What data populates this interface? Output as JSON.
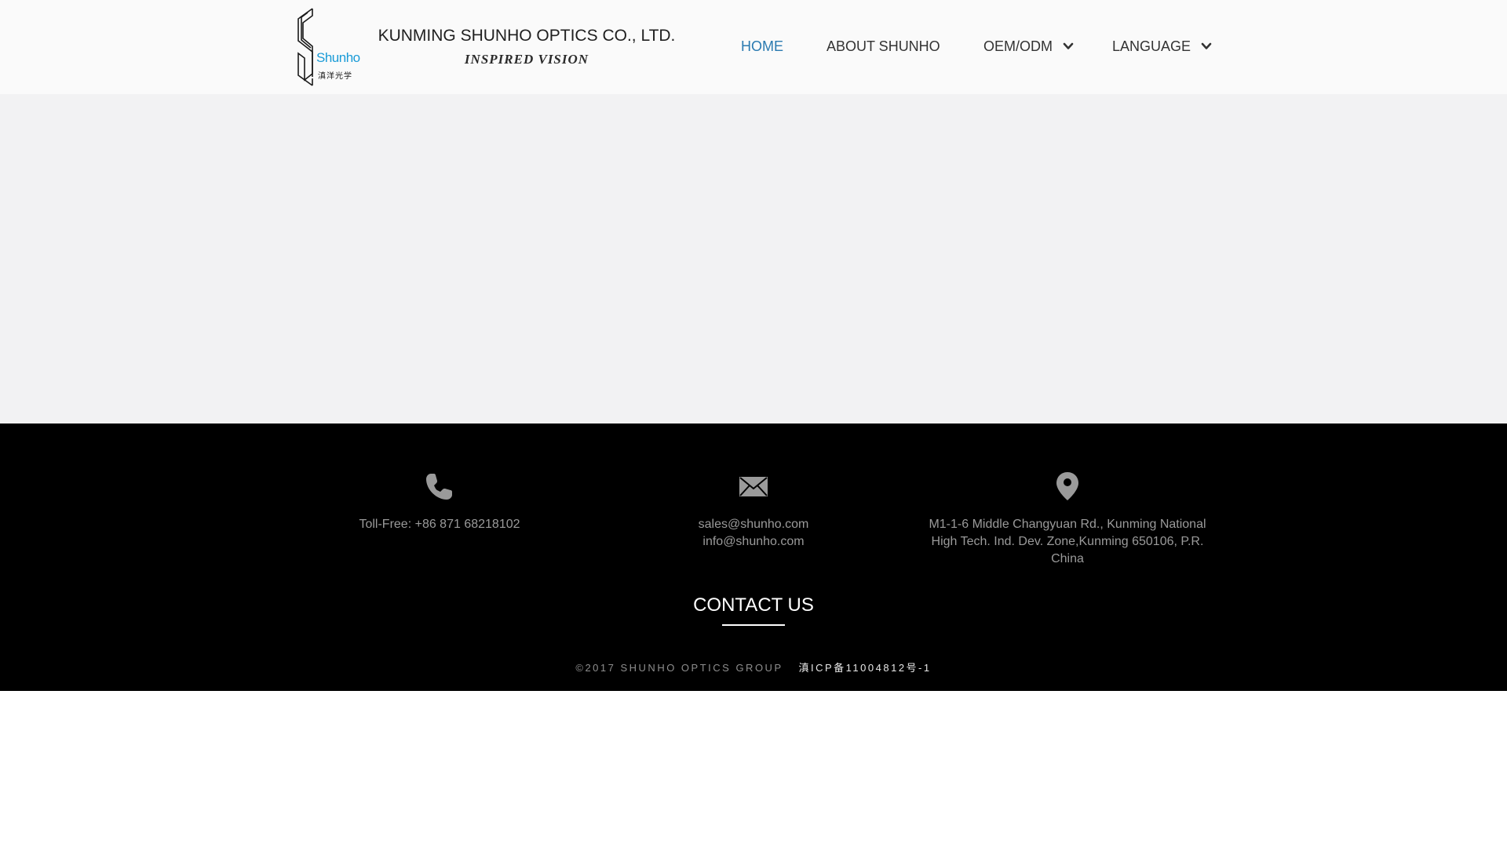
{
  "header": {
    "logo_brand": "Shunho",
    "logo_chinese": "滇洋光学",
    "company_name": "KUNMING SHUNHO OPTICS CO., LTD.",
    "tagline": "INSPIRED VISION",
    "background": "#fafafa"
  },
  "nav": {
    "items": [
      {
        "label": "HOME",
        "active": true,
        "dropdown": false
      },
      {
        "label": "ABOUT SHUNHO",
        "active": false,
        "dropdown": false
      },
      {
        "label": "OEM/ODM",
        "active": false,
        "dropdown": true,
        "icon": "chevron-down-icon"
      },
      {
        "label": "LANGUAGE",
        "active": false,
        "dropdown": true,
        "icon": "chevron-down-icon"
      }
    ],
    "active_color": "#2a7ab0"
  },
  "hero": {
    "background": "#f2f2f3"
  },
  "footer": {
    "phone": {
      "icon": "phone-icon",
      "text": "Toll-Free: +86 871 68218102"
    },
    "email": {
      "icon": "envelope-icon",
      "lines": [
        "sales@shunho.com",
        "info@shunho.com"
      ]
    },
    "address": {
      "icon": "location-pin-icon",
      "text": "M1-1-6 Middle Changyuan Rd., Kunming National High Tech. Ind. Dev. Zone,Kunming 650106, P.R. China"
    },
    "contact_title": "CONTACT US",
    "copyright": "©2017 SHUNHO OPTICS GROUP",
    "icp": "滇ICP备11004812号-1",
    "background": "#000000"
  }
}
